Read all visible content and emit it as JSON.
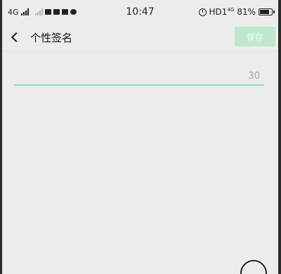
{
  "status_bar": {
    "network_1": "4G",
    "time": "10:47",
    "hd_label": "HD1",
    "net_superscript": "4G",
    "battery": "81%",
    "battery_level": 0.81
  },
  "header": {
    "title": "个性签名",
    "save_label": "保存"
  },
  "signature": {
    "value": "",
    "placeholder": "",
    "remaining": "30"
  },
  "colors": {
    "accent": "#86e0b4",
    "save_disabled_bg": "#bde8cc",
    "background": "#ececec"
  }
}
